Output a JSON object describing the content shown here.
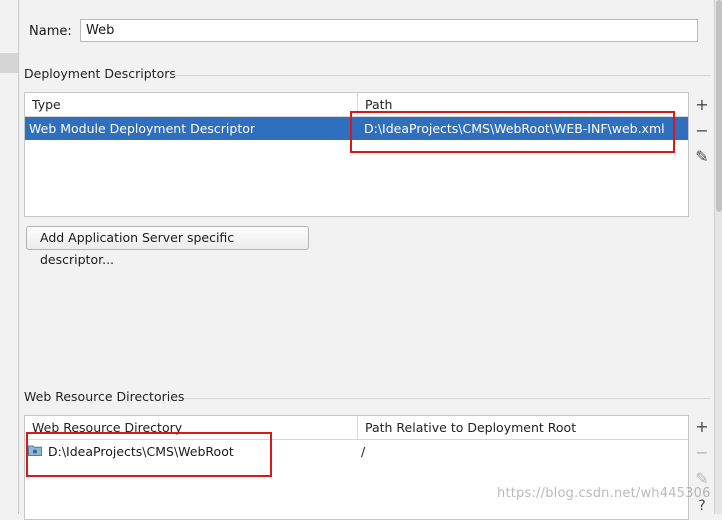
{
  "name_field": {
    "label": "Name:",
    "value": "Web"
  },
  "deployment_descriptors": {
    "title": "Deployment Descriptors",
    "columns": [
      "Type",
      "Path"
    ],
    "rows": [
      {
        "type": "Web Module Deployment Descriptor",
        "path": "D:\\IdeaProjects\\CMS\\WebRoot\\WEB-INF\\web.xml",
        "selected": true
      }
    ],
    "tools": {
      "add": "+",
      "remove": "−",
      "edit": "✎"
    }
  },
  "add_descriptor_button": {
    "label": "Add Application Server specific descriptor..."
  },
  "web_resource_directories": {
    "title": "Web Resource Directories",
    "columns": [
      "Web Resource Directory",
      "Path Relative to Deployment Root"
    ],
    "rows": [
      {
        "directory": "D:\\IdeaProjects\\CMS\\WebRoot",
        "relative_path": "/",
        "icon": "folder-icon"
      }
    ],
    "tools": {
      "add": "+",
      "remove": "−",
      "edit": "✎",
      "help": "?"
    }
  },
  "watermark": "https://blog.csdn.net/wh445306",
  "colors": {
    "selection": "#2f6fbe",
    "highlight_box": "#d71919"
  }
}
